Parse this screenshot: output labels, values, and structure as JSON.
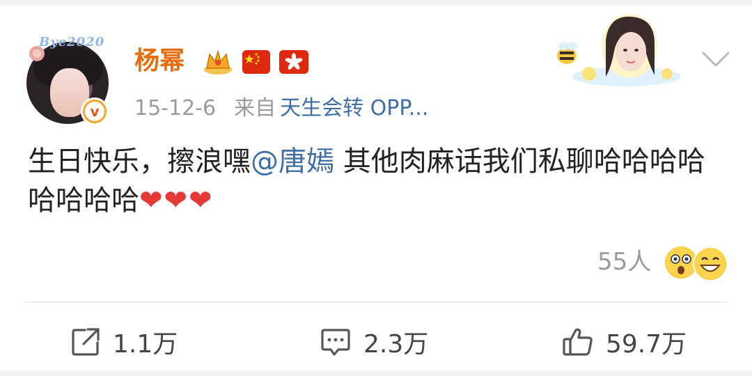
{
  "post": {
    "author": "杨幂",
    "avatar_badge_text": "Bye2020",
    "date": "15-12-6",
    "from_label": "来自",
    "source": "天生会转 OPP...",
    "content": {
      "part1": "生日快乐，擦浪嘿",
      "mention": "@唐嫣",
      "part2": " 其他肉麻话我们私聊哈哈哈哈哈哈哈哈",
      "hearts": "❤❤❤"
    },
    "reactions_count": "55人",
    "icons": {
      "crown": "crown-icon",
      "flag1": "china-flag-icon",
      "flag2": "hongkong-flag-icon",
      "verified": "verified-badge-icon",
      "more": "chevron-down-icon"
    }
  },
  "actions": {
    "repost": "1.1万",
    "comment": "2.3万",
    "like": "59.7万"
  },
  "colors": {
    "name": "#e86b0c",
    "link": "#3d6fa6",
    "meta": "#9a9a9a",
    "heart": "#e53935"
  }
}
